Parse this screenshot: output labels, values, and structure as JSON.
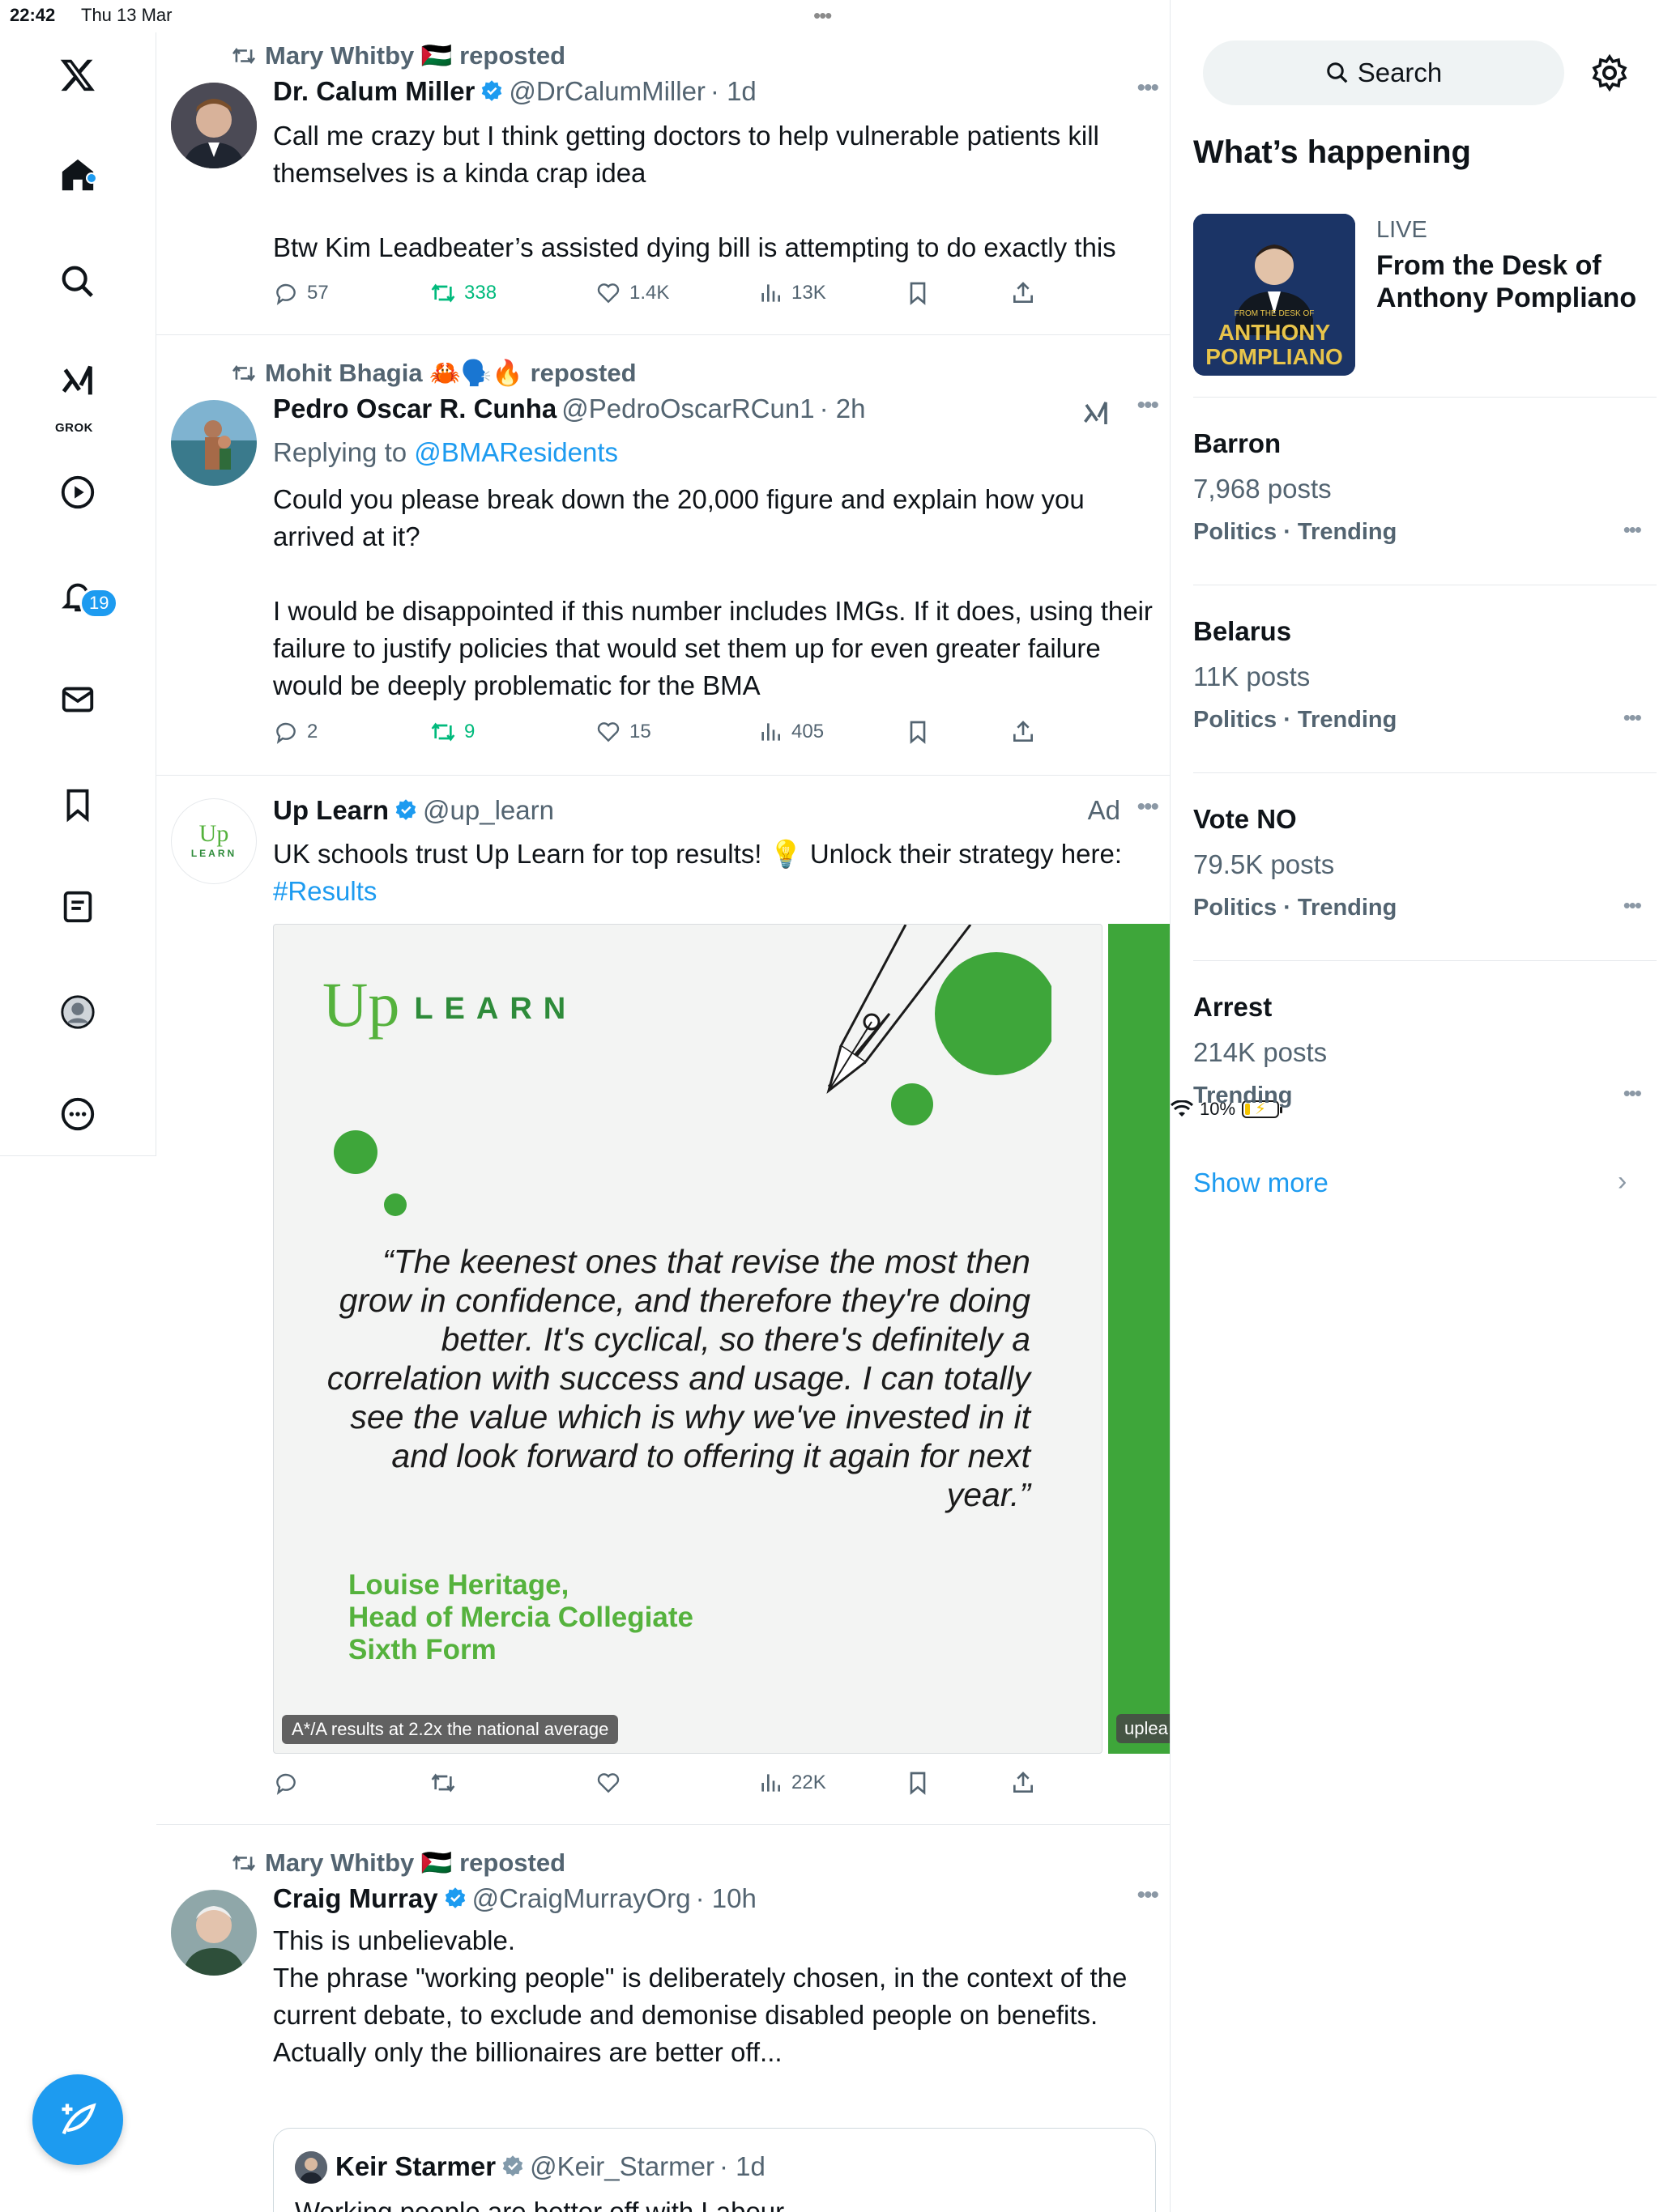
{
  "status_bar": {
    "time": "22:42",
    "date": "Thu 13 Mar",
    "battery": "10%"
  },
  "sidebar": {
    "notifications_badge": "19",
    "grok_label": "GROK",
    "icons": [
      "x-logo-icon",
      "home-icon",
      "search-icon",
      "grok-icon",
      "video-icon",
      "notifications-icon",
      "messages-icon",
      "bookmarks-icon",
      "lists-icon",
      "profile-icon",
      "more-icon",
      "compose-icon"
    ]
  },
  "posts": [
    {
      "repost_by": "Mary Whitby 🇵🇸 reposted",
      "name": "Dr. Calum Miller",
      "handle": "@DrCalumMiller",
      "time": "· 1d",
      "text": "Call me crazy but I think getting doctors to help vulnerable patients kill themselves is a kinda crap idea\n\nBtw Kim Leadbeater’s assisted dying bill is attempting to do exactly this",
      "replies": "57",
      "reposts": "338",
      "likes": "1.4K",
      "views": "13K"
    },
    {
      "repost_by": "Mohit Bhagia 🦀🗣️🔥 reposted",
      "name": "Pedro Oscar R. Cunha",
      "handle": "@PedroOscarRCun1",
      "time": "· 2h",
      "replying_prefix": "Replying to ",
      "replying_to": "@BMAResidents",
      "text": "Could you please break down the 20,000 figure and explain how you arrived at it?\n\nI would be disappointed if this number includes IMGs. If it does, using their failure to justify policies that would set them up for even greater failure would be deeply problematic for the BMA",
      "replies": "2",
      "reposts": "9",
      "likes": "15",
      "views": "405"
    },
    {
      "name": "Up Learn",
      "handle": "@up_learn",
      "ad_label": "Ad",
      "text": "UK schools trust Up Learn for top results! 💡 Unlock their strategy here: ",
      "hashtag": "#Results",
      "views": "22K",
      "card": {
        "logo_up": "Up",
        "logo_learn": "LEARN",
        "avatar_up": "Up",
        "avatar_learn": "LEARN",
        "quote": "“The keenest ones that revise the most then grow in confidence, and therefore they're doing better. It's cyclical, so there's definitely a correlation with success and usage. I can totally see the value which is why we've invested in it and look forward to offering it again for next year.”",
        "attribution_1": "Louise Heritage,",
        "attribution_2": "Head of Mercia Collegiate",
        "attribution_3": "Sixth Form",
        "pill": "A*/A results at 2.2x the national average",
        "next_pill": "uplea"
      }
    },
    {
      "repost_by": "Mary Whitby 🇵🇸 reposted",
      "name": "Craig Murray",
      "handle": "@CraigMurrayOrg",
      "time": "· 10h",
      "text": "This is unbelievable.\nThe phrase \"working people\" is deliberately chosen, in the context of the current debate, to exclude and demonise disabled people on benefits.\nActually only the billionaires are better off...",
      "quoted": {
        "name": "Keir Starmer",
        "handle": "@Keir_Starmer",
        "time": "· 1d",
        "text": "Working people are better off with Labour"
      }
    }
  ],
  "right": {
    "search_placeholder": "Search",
    "whats_happening": "What’s happening",
    "live": {
      "label": "LIVE",
      "title": "From the Desk of Anthony Pompliano",
      "thumb_small": "FROM THE DESK OF",
      "thumb_name_1": "ANTHONY",
      "thumb_name_2": "POMPLIANO"
    },
    "trends": [
      {
        "name": "Barron",
        "count": "7,968 posts",
        "category": "Politics · Trending"
      },
      {
        "name": "Belarus",
        "count": "11K posts",
        "category": "Politics · Trending"
      },
      {
        "name": "Vote NO",
        "count": "79.5K posts",
        "category": "Politics · Trending"
      },
      {
        "name": "Arrest",
        "count": "214K posts",
        "category": "Trending"
      }
    ],
    "show_more": "Show more"
  },
  "colors": {
    "accent": "#1d9bf0",
    "repost_green": "#00ba7c",
    "uplearn_green": "#55b23d"
  }
}
